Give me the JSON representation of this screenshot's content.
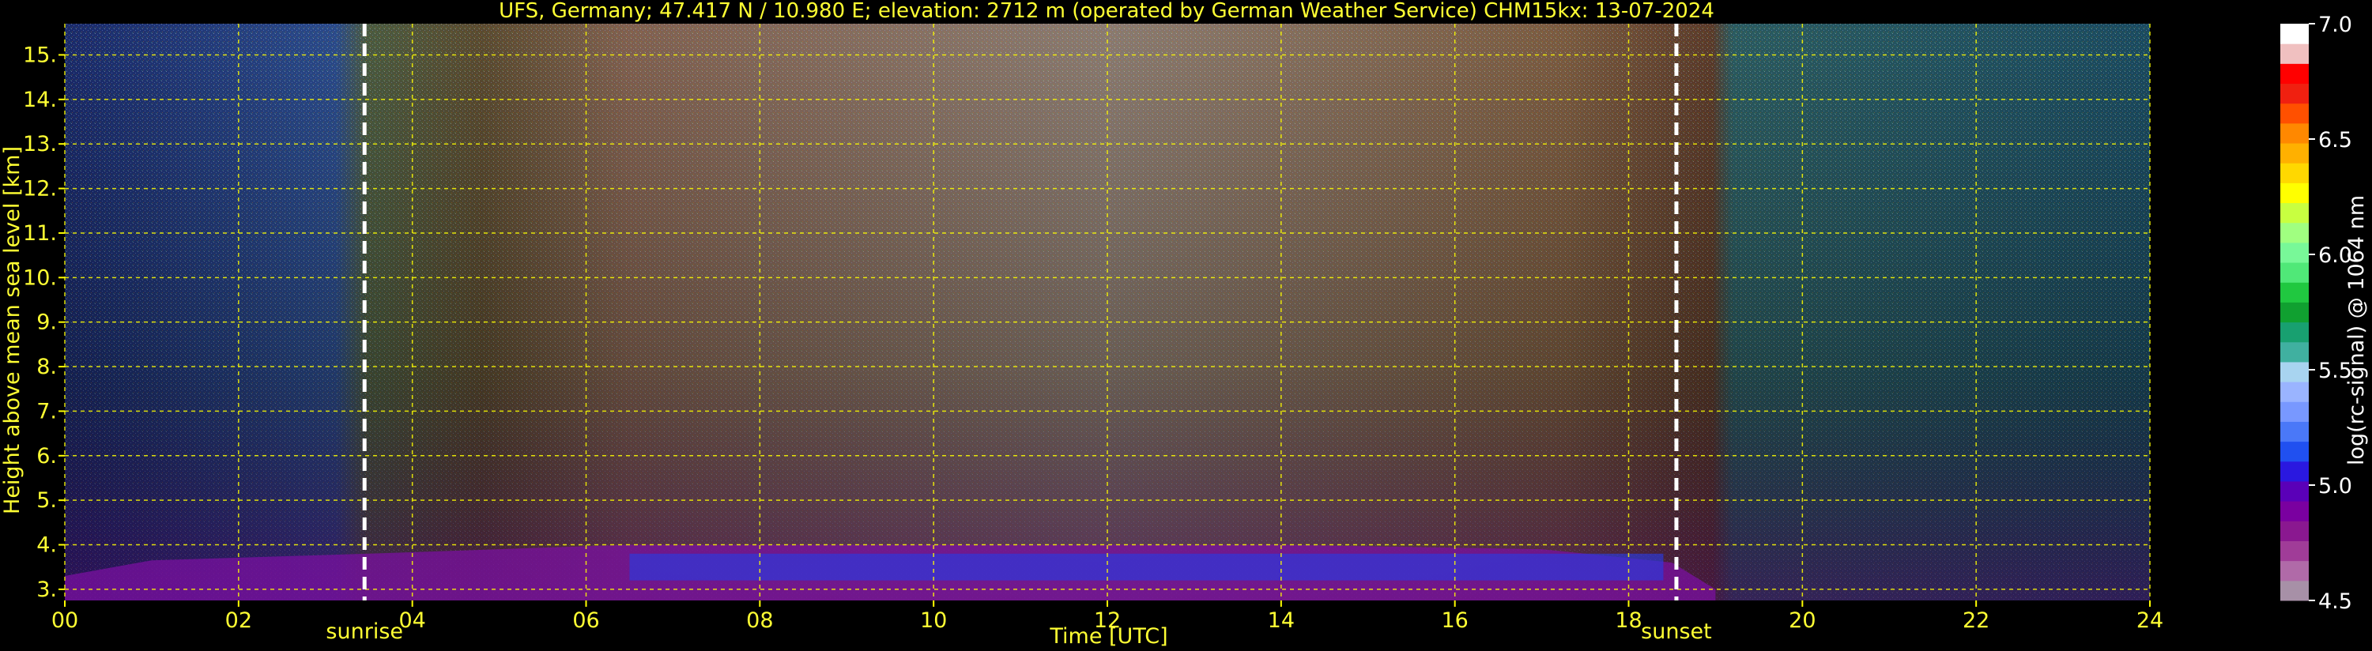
{
  "chart_data": {
    "type": "heatmap",
    "title": "UFS, Germany; 47.417 N / 10.980 E; elevation: 2712 m  (operated by German Weather Service)     CHM15kx: 13-07-2024",
    "xlabel": "Time [UTC]",
    "ylabel": "Height above mean sea level [km]",
    "xlim": [
      0,
      24
    ],
    "ylim": [
      2.75,
      15.7
    ],
    "x_ticks": [
      "00",
      "02",
      "04",
      "06",
      "08",
      "10",
      "12",
      "14",
      "16",
      "18",
      "20",
      "22",
      "24"
    ],
    "x_tick_values": [
      0,
      2,
      4,
      6,
      8,
      10,
      12,
      14,
      16,
      18,
      20,
      22,
      24
    ],
    "y_ticks": [
      "3.",
      "4.",
      "5.",
      "6.",
      "7.",
      "8.",
      "9.",
      "10.",
      "11.",
      "12.",
      "13.",
      "14.",
      "15."
    ],
    "y_tick_values": [
      3,
      4,
      5,
      6,
      7,
      8,
      9,
      10,
      11,
      12,
      13,
      14,
      15
    ],
    "grid": true,
    "annotations": [
      {
        "label": "sunrise",
        "x": 3.45
      },
      {
        "label": "sunset",
        "x": 18.55
      }
    ],
    "colorbar": {
      "label": "log(rc-signal) @ 1064 nm",
      "range": [
        4.5,
        7.0
      ],
      "ticks": [
        "7.0",
        "6.5",
        "6.0",
        "5.5",
        "5.0",
        "4.5"
      ],
      "tick_values": [
        7.0,
        6.5,
        6.0,
        5.5,
        5.0,
        4.5
      ],
      "colors": [
        "#a790a7",
        "#b06aa8",
        "#a03c98",
        "#8a1890",
        "#7a00a0",
        "#5a00b8",
        "#2a18e0",
        "#2050f0",
        "#4a78f8",
        "#7898ff",
        "#9ab4ff",
        "#a8d4f0",
        "#40b0a0",
        "#18a070",
        "#10a030",
        "#20c840",
        "#50e878",
        "#78f898",
        "#a0ff80",
        "#c8ff40",
        "#ffff00",
        "#ffd800",
        "#ffb000",
        "#ff8800",
        "#ff5000",
        "#f02010",
        "#ff0000",
        "#f0c0c0",
        "#ffffff"
      ]
    },
    "boundary_layer": [
      {
        "x": 0.0,
        "y": 3.3
      },
      {
        "x": 1.0,
        "y": 3.65
      },
      {
        "x": 3.5,
        "y": 3.8
      },
      {
        "x": 6.5,
        "y": 4.0
      },
      {
        "x": 8.0,
        "y": 4.0
      },
      {
        "x": 14.0,
        "y": 4.0
      },
      {
        "x": 17.0,
        "y": 3.9
      },
      {
        "x": 18.5,
        "y": 3.6
      },
      {
        "x": 19.0,
        "y": 3.0
      }
    ]
  }
}
